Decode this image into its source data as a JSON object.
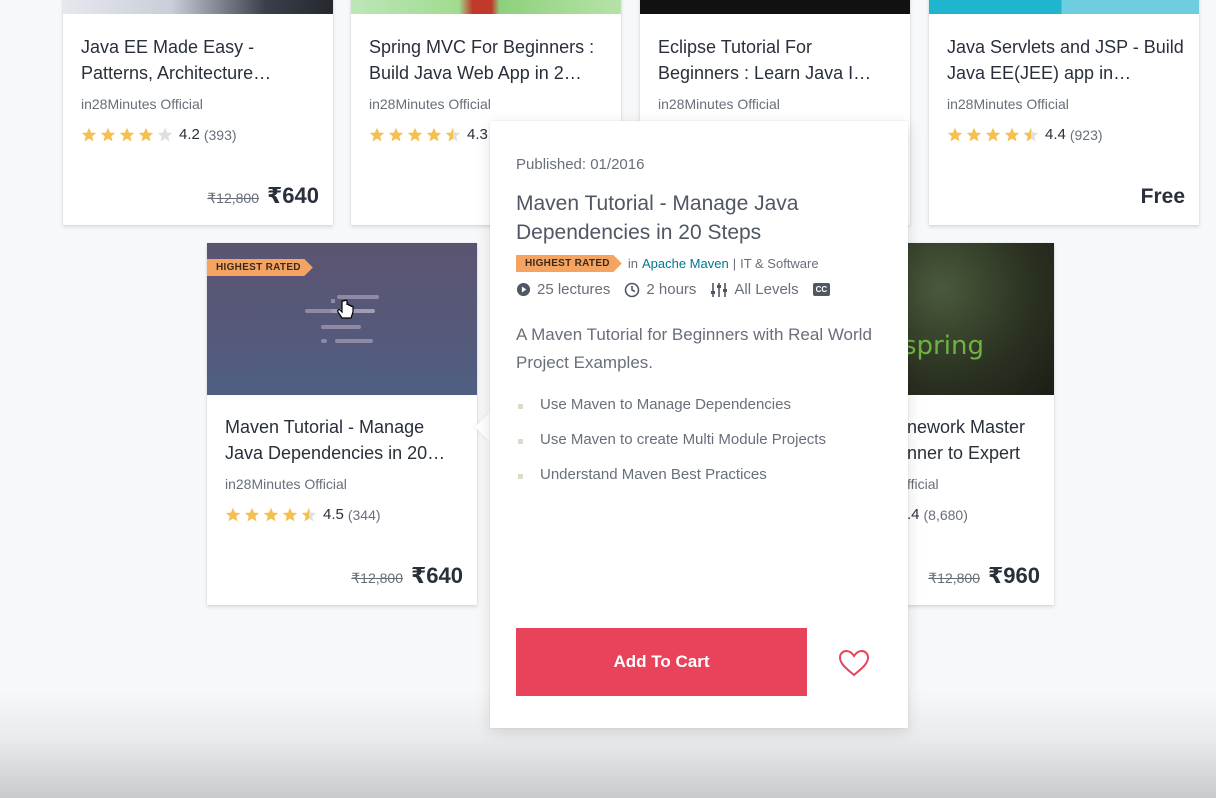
{
  "top_courses": [
    {
      "title": "Java EE Made Easy - Patterns, Architecture…",
      "author": "in28Minutes Official",
      "rating": "4.2",
      "rating_count": "(393)",
      "old_price": "₹12,800",
      "price": "₹640"
    },
    {
      "title": "Spring MVC For Beginners : Build Java Web App in 2…",
      "author": "in28Minutes Official",
      "rating": "4.3",
      "rating_count": "",
      "old_price": "",
      "price": ""
    },
    {
      "title": "Eclipse Tutorial For Beginners : Learn Java I…",
      "author": "in28Minutes Official",
      "rating": "",
      "rating_count": "",
      "old_price": "",
      "price": ""
    },
    {
      "title": "Java Servlets and JSP - Build Java EE(JEE) app in…",
      "author": "in28Minutes Official",
      "rating": "4.4",
      "rating_count": "(923)",
      "old_price": "",
      "price": "Free"
    }
  ],
  "maven_card": {
    "badge": "HIGHEST RATED",
    "title": "Maven Tutorial - Manage Java Dependencies in 20…",
    "author": "in28Minutes Official",
    "rating": "4.5",
    "rating_count": "(344)",
    "old_price": "₹12,800",
    "price": "₹640"
  },
  "spring_card": {
    "thumb_text": "spring",
    "title_line1": "nework Master",
    "title_line2": "nner to Expert",
    "author": "fficial",
    "rating": ".4",
    "rating_count": "(8,680)",
    "old_price": "₹12,800",
    "price": "₹960"
  },
  "popover": {
    "published": "Published: 01/2016",
    "title": "Maven Tutorial - Manage Java Dependencies in 20 Steps",
    "badge": "HIGHEST RATED",
    "in_label": "in",
    "category": "Apache Maven",
    "separator": "|",
    "subcategory": "IT & Software",
    "lectures": "25 lectures",
    "duration": "2 hours",
    "level": "All Levels",
    "cc": "CC",
    "description": "A Maven Tutorial for Beginners with Real World Project Examples.",
    "objectives": [
      "Use Maven to Manage Dependencies",
      "Use Maven to create Multi Module Projects",
      "Understand Maven Best Practices"
    ],
    "add_to_cart": "Add To Cart"
  },
  "ratings_fraction": {
    "java_ee": 0.84,
    "spring_mvc": 0.86,
    "servlets": 0.88,
    "maven": 0.9
  },
  "colors": {
    "star": "#f4c150",
    "badge": "#f4a460",
    "cart_button": "#e8435a",
    "link": "#007791"
  }
}
